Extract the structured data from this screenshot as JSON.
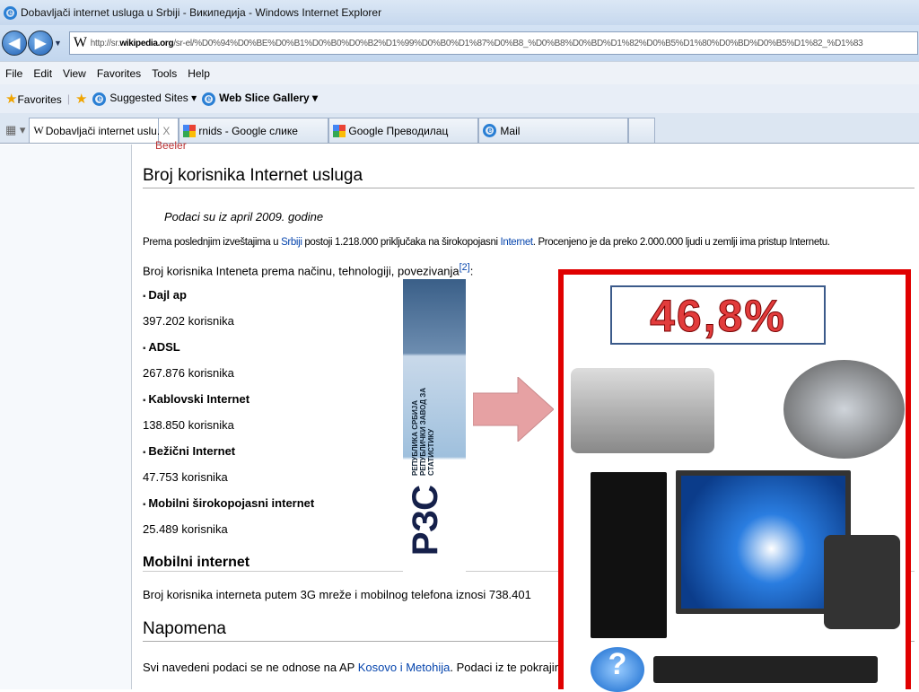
{
  "window": {
    "title": "Dobavljači internet usluga u Srbiji - Википедија - Windows Internet Explorer"
  },
  "address": {
    "prefix": "http://sr.",
    "domain": "wikipedia.org",
    "rest": "/sr-el/%D0%94%D0%BE%D0%B1%D0%B0%D0%B2%D1%99%D0%B0%D1%87%D0%B8_%D0%B8%D0%BD%D1%82%D0%B5%D1%80%D0%BD%D0%B5%D1%82_%D1%83"
  },
  "menu": [
    "File",
    "Edit",
    "View",
    "Favorites",
    "Tools",
    "Help"
  ],
  "favorites": {
    "label": "Favorites",
    "suggested": "Suggested Sites ▾",
    "webslice": "Web Slice Gallery ▾"
  },
  "tabs": [
    {
      "label": "Dobavljači internet uslu...",
      "close": "X"
    },
    {
      "label": "rnids - Google слике"
    },
    {
      "label": "Google Преводилац"
    },
    {
      "label": "Mail"
    }
  ],
  "article": {
    "cut_text": "Beeler",
    "heading1": "Broj korisnika Internet usluga",
    "note": "Podaci su iz april 2009. godine",
    "para1_a": "Prema poslednjim izveštajima u ",
    "para1_link1": "Srbiji",
    "para1_b": " postoji 1.218.000 priključaka na širokopojasni ",
    "para1_link2": "Internet",
    "para1_c": ". Procenjeno je da preko 2.000.000 ljudi u zemlji ima pristup Internetu.",
    "para2": "Broj korisnika Inteneta prema načinu, tehnologiji, povezivanja",
    "ref": "[2]",
    "colon": ":",
    "items": [
      {
        "name": "Dajl ap",
        "count": "397.202 korisnika"
      },
      {
        "name": "ADSL",
        "count": "267.876 korisnika"
      },
      {
        "name": "Kablovski Internet",
        "count": "138.850 korisnika"
      },
      {
        "name": "Bežični Internet",
        "count": "47.753 korisnika"
      },
      {
        "name": "Mobilni širokopojasni internet",
        "count": "25.489 korisnika"
      }
    ],
    "heading2": "Mobilni internet",
    "para3": "Broj korisnika interneta putem 3G mreže i mobilnog telefona iznosi 738.401",
    "heading3": "Napomena",
    "para4_a": "Svi navedeni podaci se ne odnose na AP ",
    "para4_link": "Kosovo i Metohija",
    "para4_b": ". Podaci iz te pokrajine nisu d"
  },
  "overlay": {
    "logo_text": "РЕПУБЛИКА СРБИЈА РЕПУБЛИЧКИ ЗАВОД ЗА СТАТИСТИКУ",
    "logo_mark": "РЗС",
    "percent": "46,8%"
  }
}
